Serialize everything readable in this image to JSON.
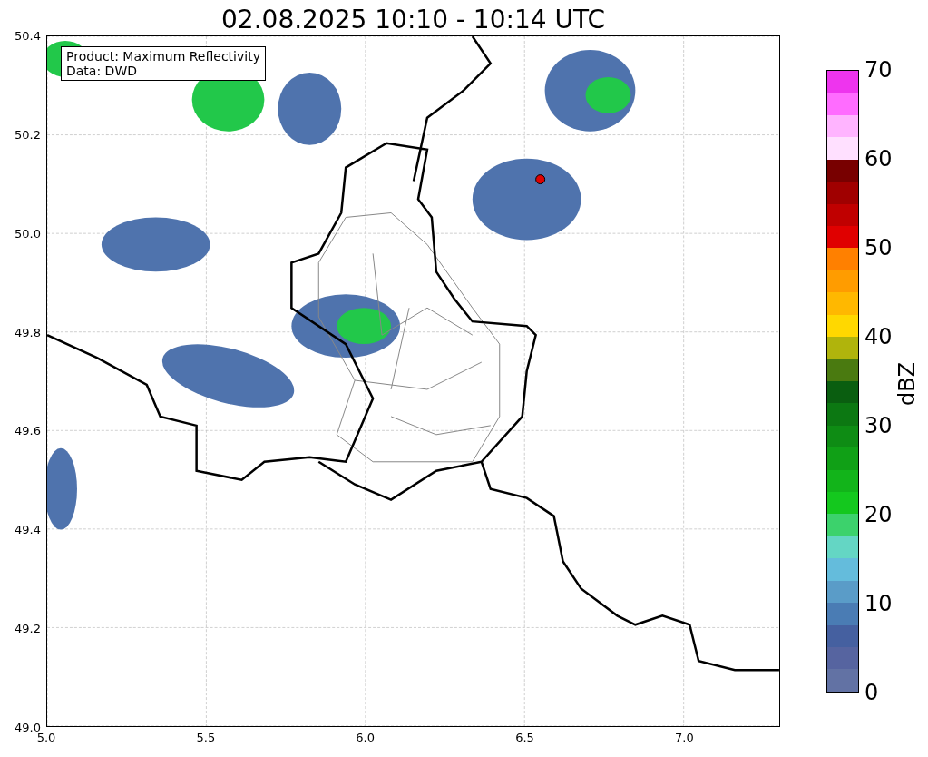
{
  "title": "02.08.2025 10:10 - 10:14 UTC",
  "legend": [
    "Product: Maximum Reflectivity",
    "Data: DWD"
  ],
  "x_ticks": [
    "5.0",
    "5.5",
    "6.0",
    "6.5",
    "7.0"
  ],
  "y_ticks": [
    "50.4",
    "50.2",
    "50.0",
    "49.8",
    "49.6",
    "49.4",
    "49.2",
    "49.0"
  ],
  "colorbar": {
    "label": "dBZ",
    "ticks": [
      "70",
      "60",
      "50",
      "40",
      "30",
      "20",
      "10",
      "0"
    ],
    "bands": [
      {
        "color": "#ee34ee"
      },
      {
        "color": "#ff6cff"
      },
      {
        "color": "#ffb4ff"
      },
      {
        "color": "#ffe0ff"
      },
      {
        "color": "#780000"
      },
      {
        "color": "#a00000"
      },
      {
        "color": "#c00000"
      },
      {
        "color": "#e00000"
      },
      {
        "color": "#ff8000"
      },
      {
        "color": "#ff9c00"
      },
      {
        "color": "#ffb800"
      },
      {
        "color": "#ffd800"
      },
      {
        "color": "#b0b40c"
      },
      {
        "color": "#4a7a10"
      },
      {
        "color": "#0a5e10"
      },
      {
        "color": "#0c7812"
      },
      {
        "color": "#0e8c14"
      },
      {
        "color": "#10a016"
      },
      {
        "color": "#12b41a"
      },
      {
        "color": "#14c81e"
      },
      {
        "color": "#3cd26c"
      },
      {
        "color": "#64d6c4"
      },
      {
        "color": "#64bcdc"
      },
      {
        "color": "#5a9cc8"
      },
      {
        "color": "#4a7cb4"
      },
      {
        "color": "#4560a0"
      },
      {
        "color": "#5664a0"
      },
      {
        "color": "#6272a4"
      }
    ]
  }
}
